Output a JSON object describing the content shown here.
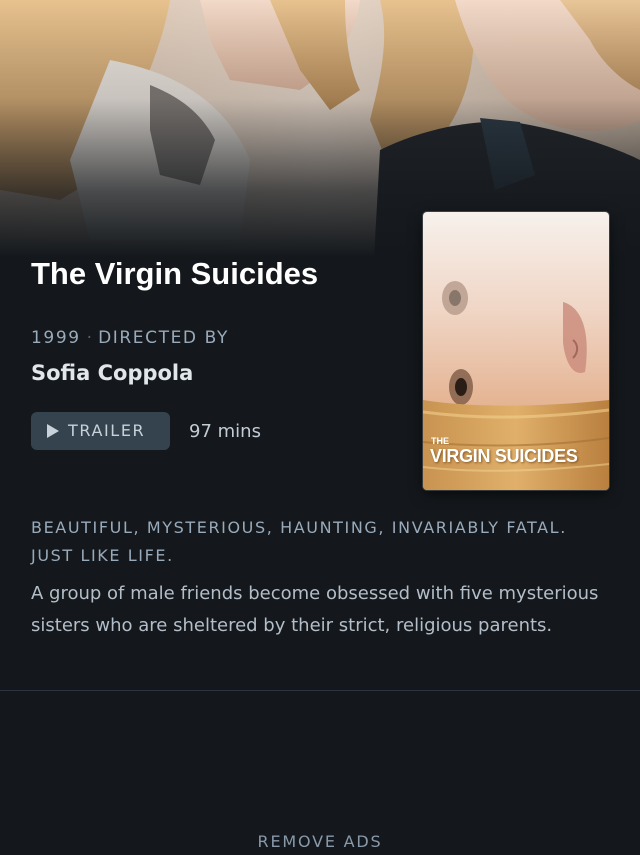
{
  "film": {
    "title": "The Virgin Suicides",
    "year": "1999",
    "directed_by_label": "DIRECTED BY",
    "director": "Sofia Coppola",
    "runtime": "97 mins",
    "tagline": "BEAUTIFUL, MYSTERIOUS, HAUNTING, INVARIABLY FATAL. JUST LIKE LIFE.",
    "synopsis": "A group of male friends become obsessed with five mysterious sisters who are sheltered by their strict, religious parents."
  },
  "actions": {
    "trailer_label": "TRAILER",
    "remove_ads_label": "REMOVE ADS"
  },
  "poster": {
    "title_small": "THE",
    "title_main": "VIRGIN SUICIDES"
  },
  "icons": {
    "play": "play-icon",
    "separator": "·"
  },
  "colors": {
    "background": "#14181c",
    "button_bg": "#35434f",
    "muted_text": "#99aabb",
    "title_text": "#ffffff"
  }
}
